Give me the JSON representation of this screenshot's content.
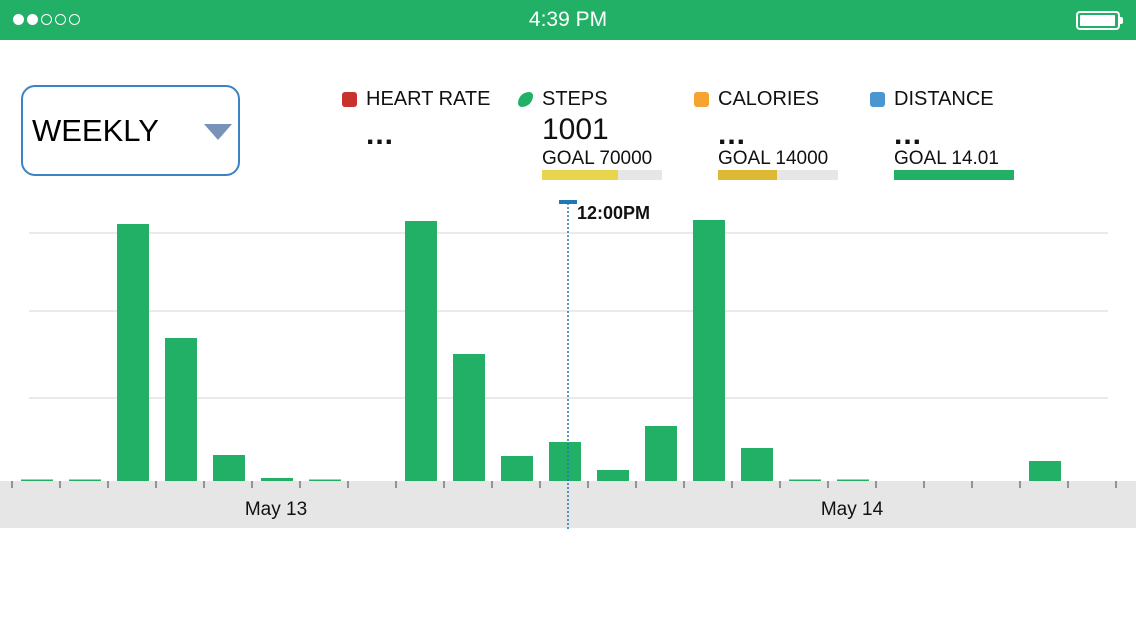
{
  "status_bar": {
    "time": "4:39 PM",
    "signal_filled": 2,
    "signal_total": 5,
    "battery_level": 0.9
  },
  "period_selector": {
    "selected": "WEEKLY",
    "icon": "dropdown-triangle-icon"
  },
  "metrics": [
    {
      "key": "heart_rate",
      "label": "HEART RATE",
      "value": "...",
      "color": "#c8322d",
      "icon": "square-icon"
    },
    {
      "key": "steps",
      "label": "STEPS",
      "value": "1001",
      "goal": "GOAL 70000",
      "progress": 0.63,
      "color": "#22b067",
      "bar_color": "#e8d44d",
      "icon": "shoe-icon"
    },
    {
      "key": "calories",
      "label": "CALORIES",
      "value": "...",
      "goal": "GOAL 14000",
      "progress": 0.49,
      "color": "#f5a430",
      "bar_color": "#ddb832",
      "icon": "square-icon"
    },
    {
      "key": "distance",
      "label": "DISTANCE",
      "value": "...",
      "goal": "GOAL 14.01",
      "progress": 1.0,
      "color": "#4a97cf",
      "bar_color": "#22b067",
      "icon": "square-icon"
    }
  ],
  "chart_data": {
    "type": "bar",
    "bar_color": "#22b067",
    "values": [
      1.5,
      1.5,
      257,
      143,
      26,
      3,
      1.5,
      0,
      260,
      127,
      25,
      39,
      11,
      55,
      261,
      33,
      1.5,
      1.5,
      0,
      0,
      0,
      20
    ],
    "ylim": [
      0,
      290
    ],
    "grid_values": [
      83,
      170,
      248
    ],
    "x_labels": [
      "May 13",
      "May 14"
    ],
    "cursor_label": "12:00PM",
    "cursor_color": "#1f77b4"
  }
}
